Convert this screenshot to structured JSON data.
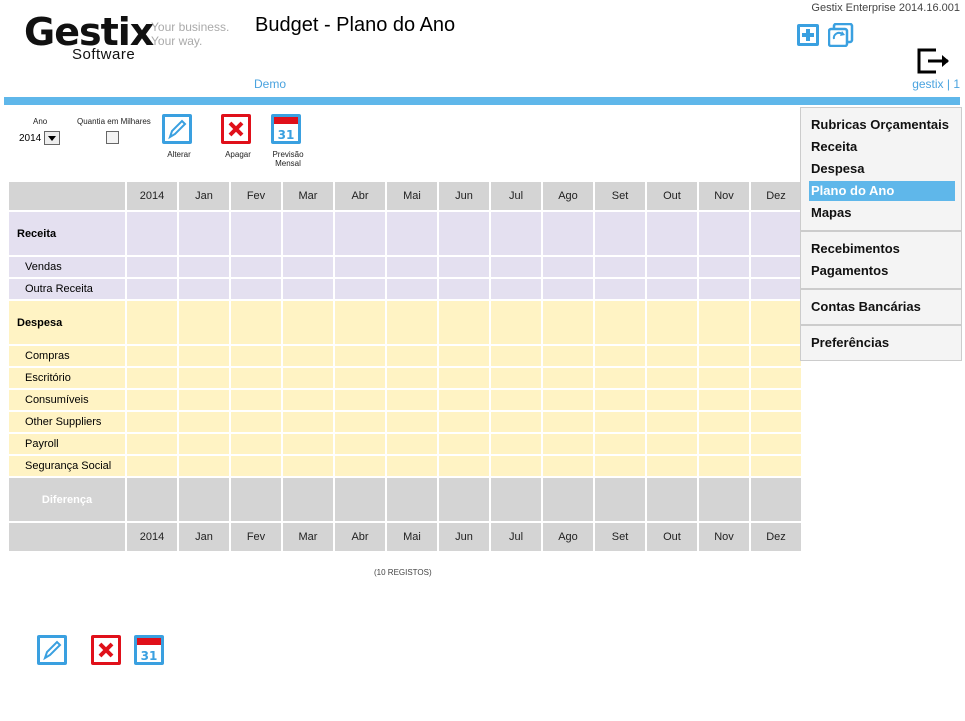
{
  "header": {
    "logo_main": "Gestix",
    "logo_sub": "Software",
    "tagline1": "Your business.",
    "tagline2": "Your way.",
    "page_title": "Budget - Plano do Ano",
    "version": "Gestix Enterprise 2014.16.001",
    "company": "Demo",
    "user": "gestix | 1"
  },
  "filters": {
    "ano_label": "Ano",
    "ano_value": "2014",
    "milhares_label": "Quantia em Milhares"
  },
  "actions": {
    "alterar": "Alterar",
    "apagar": "Apagar",
    "previsao1": "Previsão",
    "previsao2": "Mensal",
    "calendar_day": "31"
  },
  "table": {
    "columns": [
      "2014",
      "Jan",
      "Fev",
      "Mar",
      "Abr",
      "Mai",
      "Jun",
      "Jul",
      "Ago",
      "Set",
      "Out",
      "Nov",
      "Dez"
    ],
    "receita": "Receita",
    "receita_items": [
      "Vendas",
      "Outra Receita"
    ],
    "despesa": "Despesa",
    "despesa_items": [
      "Compras",
      "Escritório",
      "Consumíveis",
      "Other Suppliers",
      "Payroll",
      "Segurança Social"
    ],
    "diferenca": "Diferença",
    "records": "(10 REGISTOS)"
  },
  "sidebar": {
    "group1": [
      "Rubricas Orçamentais",
      "Receita",
      "Despesa",
      "Plano do Ano",
      "Mapas"
    ],
    "group2": [
      "Recebimentos",
      "Pagamentos"
    ],
    "group3": [
      "Contas Bancárias"
    ],
    "group4": [
      "Preferências"
    ],
    "active": "Plano do Ano"
  },
  "colors": {
    "accent": "#5fb7ea",
    "receita_bg": "#e4e0f0",
    "despesa_bg": "#fff3c4",
    "header_bg": "#d4d4d4",
    "delete_red": "#e0101a"
  }
}
